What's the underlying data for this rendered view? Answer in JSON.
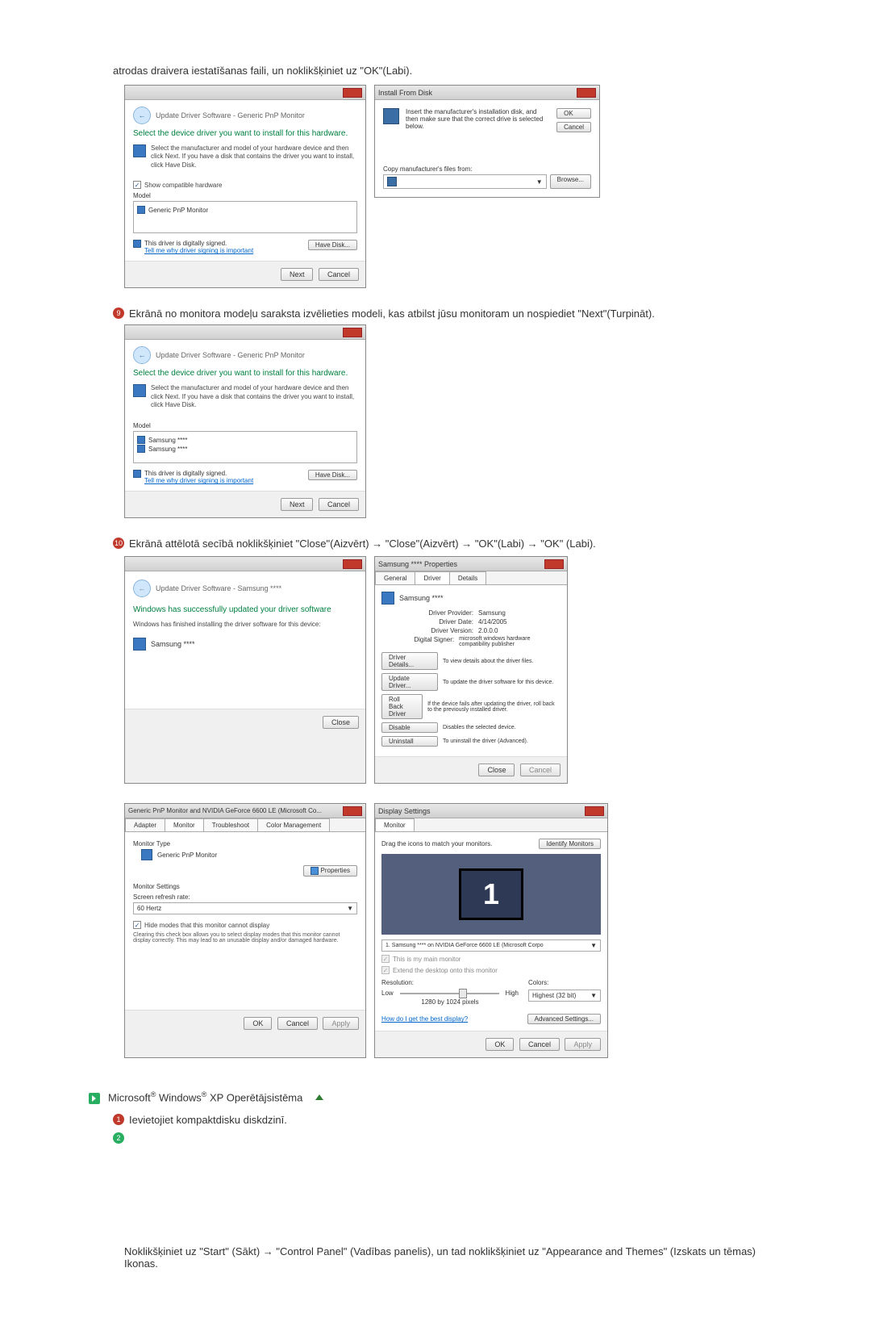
{
  "intro": "atrodas draivera iestatīšanas faili, un noklikšķiniet uz \"OK\"(Labi).",
  "driverWin1": {
    "crumb": "Update Driver Software - Generic PnP Monitor",
    "heading": "Select the device driver you want to install for this hardware.",
    "sub": "Select the manufacturer and model of your hardware device and then click Next. If you have a disk that contains the driver you want to install, click Have Disk.",
    "check": "Show compatible hardware",
    "modelLabel": "Model",
    "model": "Generic PnP Monitor",
    "signed": "This driver is digitally signed.",
    "signedLink": "Tell me why driver signing is important",
    "haveDisk": "Have Disk...",
    "next": "Next",
    "cancel": "Cancel"
  },
  "installDisk": {
    "title": "Install From Disk",
    "msg": "Insert the manufacturer's installation disk, and then make sure that the correct drive is selected below.",
    "ok": "OK",
    "cancel": "Cancel",
    "copyFrom": "Copy manufacturer's files from:",
    "browse": "Browse..."
  },
  "step9": "Ekrānā no monitora modeļu saraksta izvēlieties modeli, kas atbilst jūsu monitoram un nospiediet \"Next\"(Turpināt).",
  "driverWin2": {
    "crumb": "Update Driver Software - Generic PnP Monitor",
    "heading": "Select the device driver you want to install for this hardware.",
    "sub": "Select the manufacturer and model of your hardware device and then click Next. If you have a disk that contains the driver you want to install, click Have Disk.",
    "modelLabel": "Model",
    "m1": "Samsung ****",
    "m2": "Samsung ****",
    "signed": "This driver is digitally signed.",
    "signedLink": "Tell me why driver signing is important",
    "haveDisk": "Have Disk...",
    "next": "Next",
    "cancel": "Cancel"
  },
  "step10": "Ekrānā attēlotā secībā noklikšķiniet \"Close\"(Aizvērt) → \"Close\"(Aizvērt) → \"OK\"(Labi) → \"OK\" (Labi).",
  "winSuccess": {
    "crumb": "Update Driver Software - Samsung ****",
    "heading": "Windows has successfully updated your driver software",
    "sub": "Windows has finished installing the driver software for this device:",
    "device": "Samsung ****",
    "close": "Close"
  },
  "propsWin": {
    "title": "Samsung **** Properties",
    "tabs": [
      "General",
      "Driver",
      "Details"
    ],
    "device": "Samsung ****",
    "rows": {
      "provider_l": "Driver Provider:",
      "provider_v": "Samsung",
      "date_l": "Driver Date:",
      "date_v": "4/14/2005",
      "version_l": "Driver Version:",
      "version_v": "2.0.0.0",
      "signer_l": "Digital Signer:",
      "signer_v": "microsoft windows hardware compatibility publisher"
    },
    "btns": {
      "details": "Driver Details...",
      "details_d": "To view details about the driver files.",
      "update": "Update Driver...",
      "update_d": "To update the driver software for this device.",
      "rollback": "Roll Back Driver",
      "rollback_d": "If the device fails after updating the driver, roll back to the previously installed driver.",
      "disable": "Disable",
      "disable_d": "Disables the selected device.",
      "uninstall": "Uninstall",
      "uninstall_d": "To uninstall the driver (Advanced)."
    },
    "close": "Close",
    "cancel": "Cancel"
  },
  "monitorTab": {
    "title": "Generic PnP Monitor and NVIDIA GeForce 6600 LE (Microsoft Co...",
    "tabs": [
      "Adapter",
      "Monitor",
      "Troubleshoot",
      "Color Management"
    ],
    "typeLabel": "Monitor Type",
    "type": "Generic PnP Monitor",
    "propsBtn": "Properties",
    "settingsLabel": "Monitor Settings",
    "refreshLabel": "Screen refresh rate:",
    "refresh": "60 Hertz",
    "hideCheck": "Hide modes that this monitor cannot display",
    "hideDesc": "Clearing this check box allows you to select display modes that this monitor cannot display correctly. This may lead to an unusable display and/or damaged hardware.",
    "ok": "OK",
    "cancel": "Cancel",
    "apply": "Apply"
  },
  "displaySettings": {
    "title": "Display Settings",
    "tab": "Monitor",
    "drag": "Drag the icons to match your monitors.",
    "identify": "Identify Monitors",
    "one": "1",
    "select": "1. Samsung **** on NVIDIA GeForce 6600 LE (Microsoft Corpo",
    "main": "This is my main monitor",
    "extend": "Extend the desktop onto this monitor",
    "resLabel": "Resolution:",
    "low": "Low",
    "high": "High",
    "resVal": "1280 by 1024 pixels",
    "colorsLabel": "Colors:",
    "colors": "Highest (32 bit)",
    "bestLink": "How do I get the best display?",
    "advanced": "Advanced Settings...",
    "ok": "OK",
    "cancel": "Cancel",
    "apply": "Apply"
  },
  "xp": {
    "title_pre": "Microsoft",
    "title_mid": " Windows",
    "title_post": " XP Operētājsistēma",
    "step1": "Ievietojiet kompaktdisku diskdzinī.",
    "para": "Noklikšķiniet uz \"Start\" (Sākt) → \"Control Panel\" (Vadības panelis), un tad noklikšķiniet uz \"Appearance and Themes\" (Izskats un tēmas) Ikonas."
  }
}
